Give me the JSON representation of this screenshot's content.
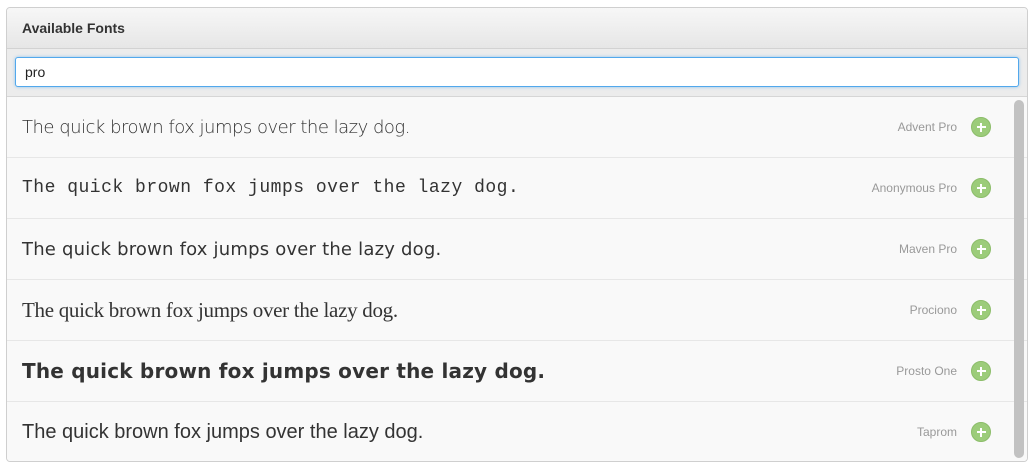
{
  "panel": {
    "title": "Available Fonts"
  },
  "search": {
    "value": "pro",
    "placeholder": ""
  },
  "fonts": [
    {
      "name": "Advent Pro",
      "sample": "The quick brown fox jumps over the lazy dog."
    },
    {
      "name": "Anonymous Pro",
      "sample": "The quick brown fox jumps over the lazy dog."
    },
    {
      "name": "Maven Pro",
      "sample": "The quick brown fox jumps over the lazy dog."
    },
    {
      "name": "Prociono",
      "sample": "The quick brown fox jumps over the lazy dog."
    },
    {
      "name": "Prosto One",
      "sample": "The quick brown fox jumps over the lazy dog."
    },
    {
      "name": "Taprom",
      "sample": "The quick brown fox jumps over the lazy dog."
    }
  ],
  "icons": {
    "add": "plus-circle-icon"
  },
  "colors": {
    "add_button": "#9ccc7a",
    "focus_border": "#52a8ec"
  }
}
